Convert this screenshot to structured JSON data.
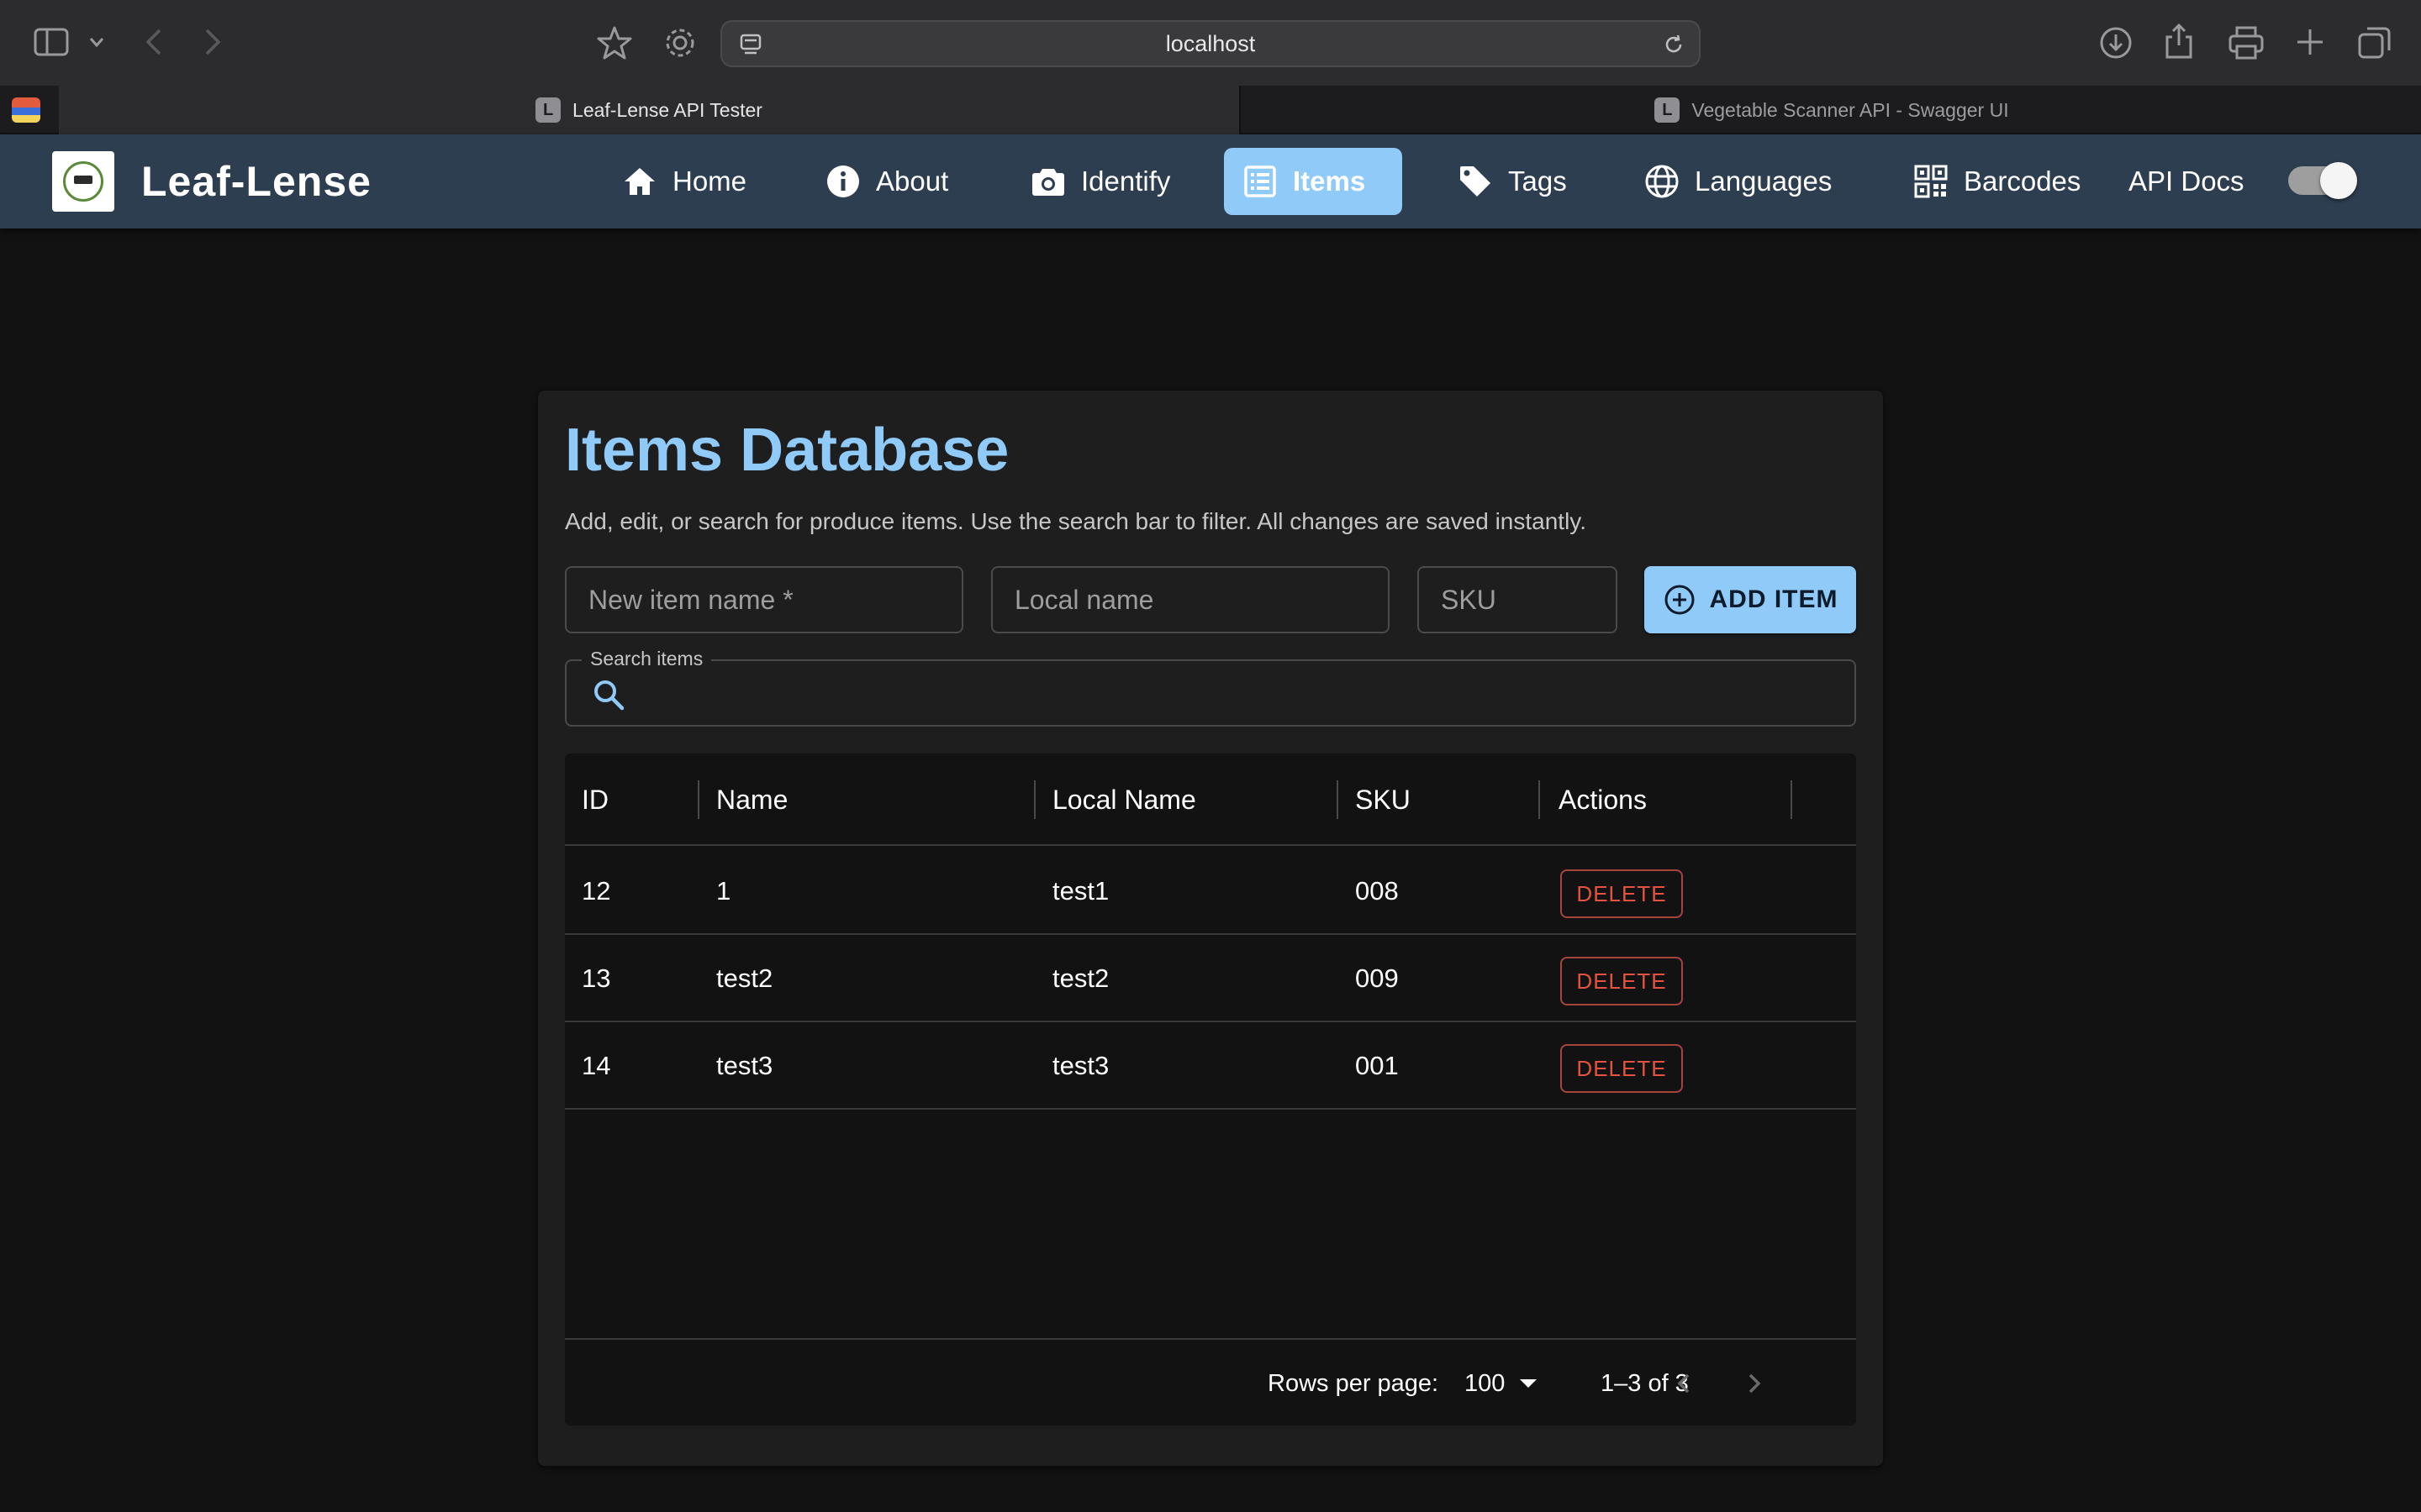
{
  "browser": {
    "url": "localhost",
    "tabs": [
      {
        "label": "Leaf-Lense API Tester",
        "favicon": "L",
        "active": true
      },
      {
        "label": "Vegetable Scanner API - Swagger UI",
        "favicon": "L",
        "active": false
      }
    ]
  },
  "app": {
    "brand": "Leaf-Lense",
    "nav": [
      {
        "label": "Home",
        "icon": "home-icon"
      },
      {
        "label": "About",
        "icon": "info-icon"
      },
      {
        "label": "Identify",
        "icon": "camera-icon"
      },
      {
        "label": "Items",
        "icon": "list-icon",
        "active": true
      },
      {
        "label": "Tags",
        "icon": "tag-icon"
      },
      {
        "label": "Languages",
        "icon": "globe-icon"
      },
      {
        "label": "Barcodes",
        "icon": "qr-code-icon"
      },
      {
        "label": "API Docs"
      }
    ],
    "theme_toggle": {
      "on": true
    }
  },
  "page": {
    "title": "Items Database",
    "subtitle": "Add, edit, or search for produce items. Use the search bar to filter. All changes are saved instantly.",
    "form": {
      "name_placeholder": "New item name *",
      "local_placeholder": "Local name",
      "sku_placeholder": "SKU",
      "add_label": "ADD ITEM"
    },
    "search": {
      "label": "Search items",
      "value": ""
    }
  },
  "table": {
    "columns": [
      "ID",
      "Name",
      "Local Name",
      "SKU",
      "Actions"
    ],
    "rows": [
      {
        "id": "12",
        "name": "1",
        "local": "test1",
        "sku": "008",
        "action": "DELETE"
      },
      {
        "id": "13",
        "name": "test2",
        "local": "test2",
        "sku": "009",
        "action": "DELETE"
      },
      {
        "id": "14",
        "name": "test3",
        "local": "test3",
        "sku": "001",
        "action": "DELETE"
      }
    ],
    "pagination": {
      "rows_per_page_label": "Rows per page:",
      "rows_per_page": "100",
      "range": "1–3 of 3"
    }
  },
  "colors": {
    "appbar": "#2d3e50",
    "accent": "#90caf9",
    "danger": "#e5533f",
    "background": "#121212"
  }
}
